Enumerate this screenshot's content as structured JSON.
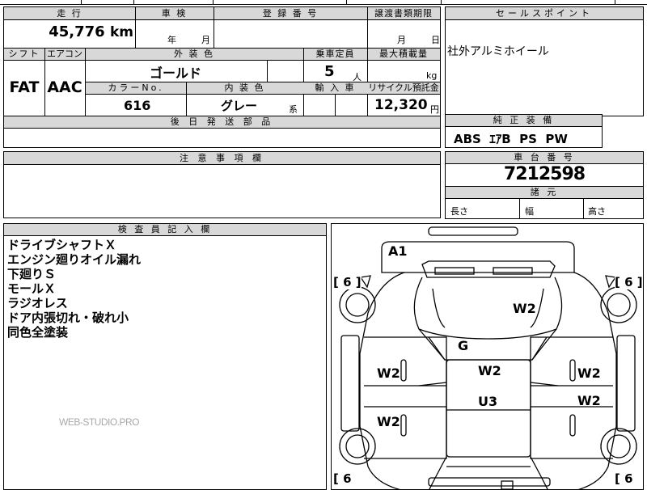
{
  "top_fragment": "車検",
  "header_labels": {
    "mileage": "走 行",
    "inspection": "車 検",
    "registration": "登 録 番 号",
    "transfer": "譲渡書類期限",
    "sale_points": "セールスポイント",
    "shift": "シフト",
    "aircon": "エアコン",
    "exterior_color": "外 装 色",
    "capacity": "乗車定員",
    "max_load": "最大積載量",
    "color_no": "カラーNo.",
    "interior_color": "内 装 色",
    "import": "輸 入 車",
    "recycle": "リサイクル預託金",
    "later_parts": "後 日 発 送 部 品",
    "genuine": "純 正 装 備",
    "caution": "注 意 事 項 欄",
    "chassis_no": "車 台 番 号",
    "dimensions": "諸 元",
    "inspector": "検 査 員 記 入 欄"
  },
  "values": {
    "mileage": "45,776",
    "mileage_unit": "km",
    "year_unit": "年",
    "month_unit": "月",
    "transfer_month": "月",
    "transfer_day": "日",
    "sale_point": "社外アルミホイール",
    "shift": "FAT",
    "aircon": "AAC",
    "exterior_color": "ゴールド",
    "capacity": "5",
    "capacity_unit": "人",
    "load_unit": "kg",
    "color_no": "616",
    "interior_color": "グレー",
    "interior_suffix": "系",
    "recycle": "12,320",
    "recycle_unit": "円",
    "genuine": "ABS  ｴｱB  PS  PW",
    "chassis_no": "7212598",
    "length": "長さ",
    "width": "幅",
    "height": "高さ"
  },
  "inspector_notes": [
    "ドライブシャフトＸ",
    "エンジン廻りオイル漏れ",
    "下廻りＳ",
    "モールＸ",
    "ラジオレス",
    "ドア内張切れ・破れ小",
    "同色全塗装"
  ],
  "watermark": "WEB-STUDIO.PRO",
  "diagram_marks": {
    "a1": "A1",
    "w2_hood": "W2",
    "g": "G",
    "w2_left_front": "W2",
    "w2_center": "W2",
    "w2_right_front": "W2",
    "u3": "U3",
    "w2_right_rear": "W2",
    "w2_left_rear": "W2",
    "tire_fl": "[ 6 ]",
    "tire_fr": "[ 6 ]",
    "tire_rl": "[ 6",
    "tire_rr": "[ 6"
  }
}
